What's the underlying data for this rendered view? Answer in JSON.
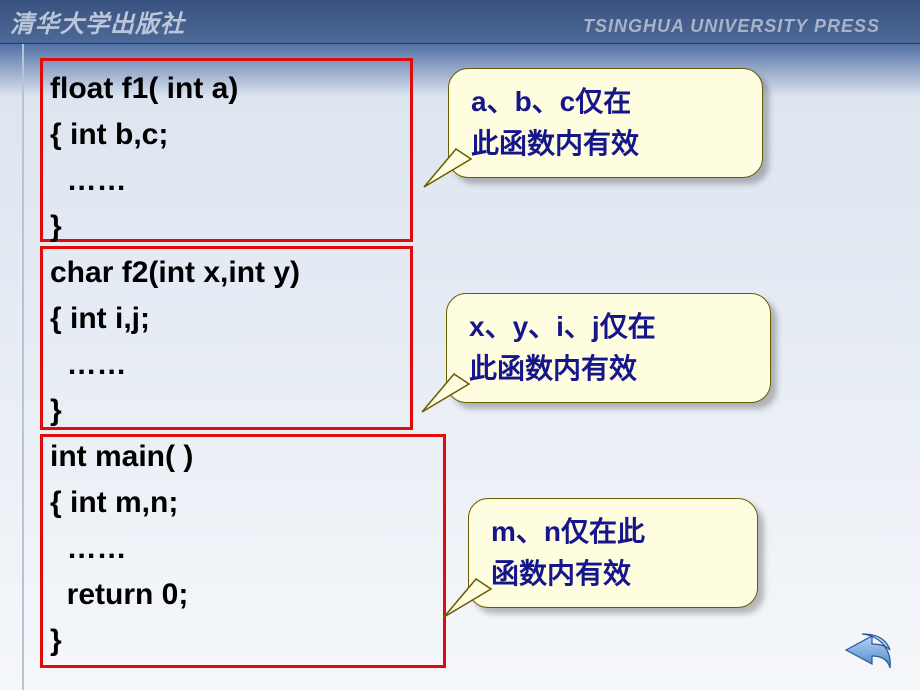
{
  "titlebar": {
    "cn": "清华大学出版社",
    "en": "TSINGHUA UNIVERSITY PRESS"
  },
  "code": {
    "l1": "float f1( int a)",
    "l2": "{ int b,c;",
    "l3": "  ……",
    "l4": "}",
    "l5": "char f2(int x,int y)",
    "l6": "{ int i,j;",
    "l7": "  ……",
    "l8": "}",
    "l9": "int main( )",
    "l10": "{ int m,n;",
    "l11": "  ……",
    "l12": "  return 0;",
    "l13": "}"
  },
  "callouts": {
    "c1_l1": "a、b、c仅在",
    "c1_l2": "此函数内有效",
    "c2_l1": "x、y、i、j仅在",
    "c2_l2": "此函数内有效",
    "c3_l1": "m、n仅在此",
    "c3_l2": "函数内有效"
  },
  "icons": {
    "back": "back-arrow-icon"
  }
}
